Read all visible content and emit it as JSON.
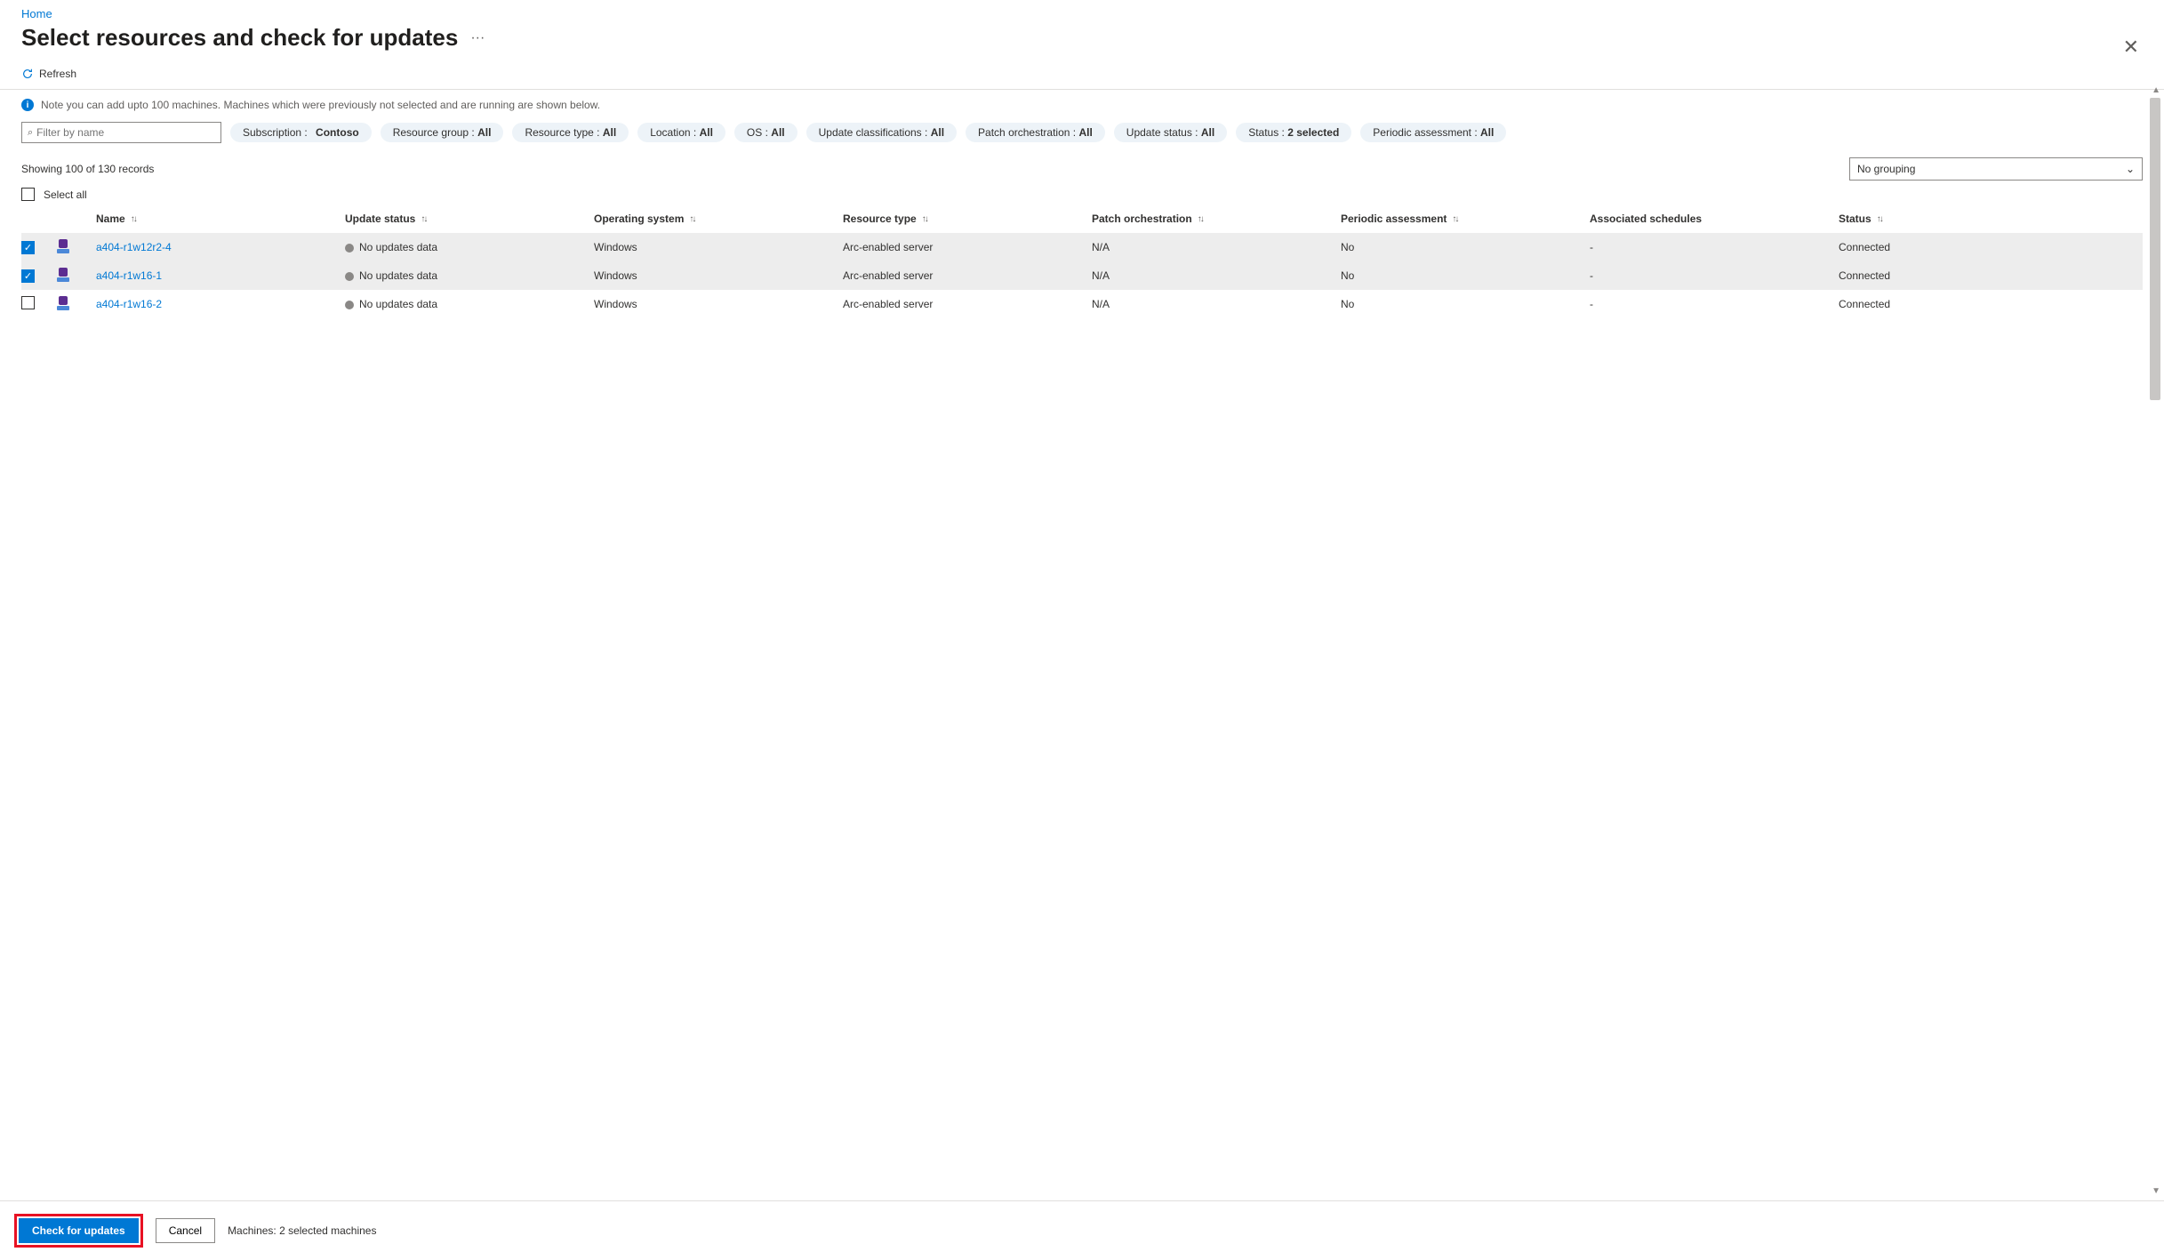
{
  "breadcrumb": {
    "home": "Home"
  },
  "header": {
    "title": "Select resources and check for updates",
    "more": "···"
  },
  "toolbar": {
    "refresh": "Refresh"
  },
  "info": {
    "text": "Note you can add upto 100 machines. Machines which were previously not selected and are running are shown below."
  },
  "search": {
    "placeholder": "Filter by name"
  },
  "filters": {
    "subscription_label": "Subscription :",
    "subscription_value": "Contoso",
    "resource_group_label": "Resource group :",
    "resource_group_value": "All",
    "resource_type_label": "Resource type :",
    "resource_type_value": "All",
    "location_label": "Location :",
    "location_value": "All",
    "os_label": "OS :",
    "os_value": "All",
    "update_class_label": "Update classifications :",
    "update_class_value": "All",
    "patch_orch_label": "Patch orchestration :",
    "patch_orch_value": "All",
    "update_status_label": "Update status :",
    "update_status_value": "All",
    "status_label": "Status :",
    "status_value": "2 selected",
    "periodic_label": "Periodic assessment :",
    "periodic_value": "All"
  },
  "records": {
    "text": "Showing 100 of 130 records"
  },
  "grouping": {
    "selected": "No grouping"
  },
  "select_all": {
    "label": "Select all"
  },
  "columns": {
    "name": "Name",
    "update_status": "Update status",
    "os": "Operating system",
    "resource_type": "Resource type",
    "patch_orch": "Patch orchestration",
    "periodic": "Periodic assessment",
    "schedules": "Associated schedules",
    "status": "Status"
  },
  "rows": [
    {
      "selected": true,
      "name": "a404-r1w12r2-4",
      "update_status": "No updates data",
      "os": "Windows",
      "resource_type": "Arc-enabled server",
      "patch_orch": "N/A",
      "periodic": "No",
      "schedules": "-",
      "status": "Connected"
    },
    {
      "selected": true,
      "name": "a404-r1w16-1",
      "update_status": "No updates data",
      "os": "Windows",
      "resource_type": "Arc-enabled server",
      "patch_orch": "N/A",
      "periodic": "No",
      "schedules": "-",
      "status": "Connected"
    },
    {
      "selected": false,
      "name": "a404-r1w16-2",
      "update_status": "No updates data",
      "os": "Windows",
      "resource_type": "Arc-enabled server",
      "patch_orch": "N/A",
      "periodic": "No",
      "schedules": "-",
      "status": "Connected"
    }
  ],
  "footer": {
    "check": "Check for updates",
    "cancel": "Cancel",
    "status": "Machines: 2 selected machines"
  }
}
